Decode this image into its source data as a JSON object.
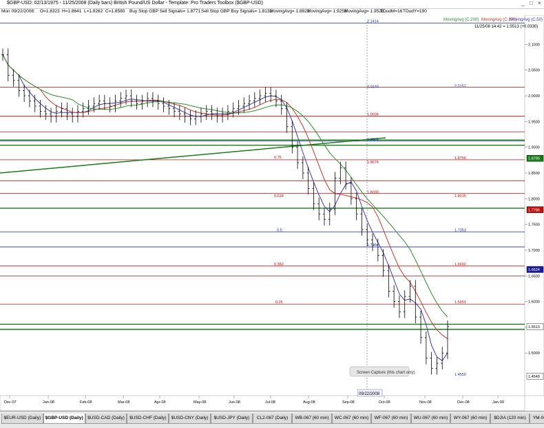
{
  "window": {
    "title": "$GBP-USD:  02/13/1975 - 11/25/2008  (Daily bars)   British Pound/US Dollar  -  Template: Pro Traders Toolbox ($GBP-USD)"
  },
  "info": {
    "date": "Mon 09/22/2008:",
    "o": "O=1.8323",
    "h": "H=1.8641",
    "l": "L=1.8262",
    "c": "C=1.8580",
    "buy_stop_sell": "Buy Stop GBP Sell Signals= 1.8771",
    "sell_stop_buy": "Sell Stop GBP Buy Signals= 1.8132",
    "ma1": "MovingAvg= 1.8822",
    "ma2": "MovingAvg= 1.9258",
    "ma3": "MovingAvg= 1.9528",
    "tdudm": "TDudM=16",
    "tdudy": "TDudY=190"
  },
  "legend": {
    "ma200": "MovingAvg (C,200)",
    "ma100": "MovingAvg (C,100)",
    "ma50": "MovingAvg (C,50)",
    "status": "11/25/08 14:42 = 1.5513 (+0.0330)",
    "colors": {
      "ma200": "#2e8b2e",
      "ma100": "#c0392b",
      "ma50": "#3a3ab0"
    }
  },
  "chart_data": {
    "type": "candlestick",
    "ylim": [
      1.44,
      2.13
    ],
    "y_ticks": [
      "2.1000",
      "2.0500",
      "2.0000",
      "1.9500",
      "1.9000",
      "1.8500",
      "1.8000",
      "1.7500",
      "1.7000",
      "1.6500",
      "1.6000",
      "1.5500",
      "1.5000"
    ],
    "x_ticks": [
      "Dec-07",
      "Jan-08",
      "Feb-08",
      "Mar-08",
      "Apr-08",
      "May-08",
      "Jun-08",
      "Jul-08",
      "Aug-08",
      "Sep-08",
      "Oct-08",
      "Nov-08",
      "Dec-08",
      "Jan-09"
    ],
    "cursor_date": "09/22/2008",
    "right_axis_markers": [
      {
        "label": "1.8785",
        "value": 1.8785,
        "color": "#1a7a1a"
      },
      {
        "label": "1.7786",
        "value": 1.7786,
        "color": "#c01010"
      },
      {
        "label": "1.6624",
        "value": 1.6624,
        "color": "#1a1a9a"
      },
      {
        "label": "1.5513",
        "value": 1.5513,
        "color": "#000000"
      },
      {
        "label": "1.4549",
        "value": 1.4549,
        "color": "#000000"
      }
    ],
    "level_labels": [
      {
        "label": "2.1414",
        "value": 2.1414,
        "color": "#2030a0"
      },
      {
        "label": "2.0140",
        "value": 2.014,
        "color": "#2030a0"
      },
      {
        "label": "2.0157",
        "value": 2.0157,
        "color": "#2030a0"
      },
      {
        "label": "1.9604",
        "value": 1.9604,
        "color": "#c01010"
      },
      {
        "label": "1.9119",
        "value": 1.9119,
        "color": "#2030a0"
      },
      {
        "label": "0.75",
        "value": 1.877,
        "color": "#c01010"
      },
      {
        "label": "1.8756",
        "value": 1.8756,
        "color": "#c01010"
      },
      {
        "label": "1.8674",
        "value": 1.8674,
        "color": "#c01010"
      },
      {
        "label": "1.8090",
        "value": 1.809,
        "color": "#c01010"
      },
      {
        "label": "0.618",
        "value": 1.8015,
        "color": "#c01010"
      },
      {
        "label": "1.8015",
        "value": 1.8015,
        "color": "#c01010"
      },
      {
        "label": "0.5",
        "value": 1.7353,
        "color": "#2030a0"
      },
      {
        "label": "1.7353",
        "value": 1.7353,
        "color": "#2030a0"
      },
      {
        "label": "1.7064",
        "value": 1.7064,
        "color": "#2030a0"
      },
      {
        "label": "0.382",
        "value": 1.6692,
        "color": "#c01010"
      },
      {
        "label": "1.6692",
        "value": 1.6692,
        "color": "#c01010"
      },
      {
        "label": "0.25",
        "value": 1.5951,
        "color": "#c01010"
      },
      {
        "label": "1.5951",
        "value": 1.5951,
        "color": "#c01010"
      },
      {
        "label": "1.4550",
        "value": 1.455,
        "color": "#2030a0"
      }
    ],
    "horizontal_lines": [
      {
        "value": 2.1414,
        "color": "#2030a0"
      },
      {
        "value": 2.017,
        "color": "#8b1a1a"
      },
      {
        "value": 1.9604,
        "color": "#c01010"
      },
      {
        "value": 1.93,
        "color": "#8b1a1a"
      },
      {
        "value": 1.914,
        "color": "#1a7a1a"
      },
      {
        "value": 1.9119,
        "color": "#2030a0"
      },
      {
        "value": 1.904,
        "color": "#1a7a1a"
      },
      {
        "value": 1.8756,
        "color": "#c01010"
      },
      {
        "value": 1.835,
        "color": "#8b1a1a"
      },
      {
        "value": 1.8105,
        "color": "#c01010"
      },
      {
        "value": 1.7815,
        "color": "#1a7a1a"
      },
      {
        "value": 1.7353,
        "color": "#2030a0"
      },
      {
        "value": 1.7064,
        "color": "#2030a0"
      },
      {
        "value": 1.6692,
        "color": "#c01010"
      },
      {
        "value": 1.65,
        "color": "#8b1a1a"
      },
      {
        "value": 1.5951,
        "color": "#c01010"
      },
      {
        "value": 1.556,
        "color": "#1a7a1a"
      },
      {
        "value": 1.546,
        "color": "#1a7a1a"
      }
    ],
    "close_series": [
      2.08,
      2.04,
      2.03,
      2.01,
      2.0,
      1.99,
      1.98,
      1.97,
      1.965,
      1.96,
      1.97,
      1.975,
      1.965,
      1.96,
      1.97,
      1.975,
      1.98,
      1.985,
      1.99,
      1.985,
      1.98,
      1.99,
      1.995,
      2.0,
      1.99,
      1.985,
      1.99,
      1.995,
      1.99,
      1.985,
      1.98,
      1.975,
      1.97,
      1.965,
      1.96,
      1.955,
      1.96,
      1.965,
      1.97,
      1.965,
      1.96,
      1.965,
      1.97,
      1.975,
      1.98,
      1.985,
      1.99,
      1.995,
      2.0,
      2.005,
      2.0,
      1.99,
      1.975,
      1.94,
      1.9,
      1.87,
      1.85,
      1.82,
      1.79,
      1.77,
      1.76,
      1.78,
      1.84,
      1.86,
      1.83,
      1.8,
      1.77,
      1.74,
      1.72,
      1.71,
      1.69,
      1.66,
      1.62,
      1.6,
      1.58,
      1.61,
      1.63,
      1.57,
      1.53,
      1.49,
      1.47,
      1.48,
      1.5,
      1.5513
    ]
  },
  "annotation": "Screen Capture (this chart only)",
  "tabs": [
    "$EUR-USD (Daily)",
    "$GBP-USD (Daily)",
    "$USD-CAD (Daily)",
    "$USD-CHF (Daily)",
    "$USD-CNY (Daily)",
    "$USD-JPY (Daily)",
    "CL2-067 (Daily)",
    "WB-067 (60 min)",
    "WC-067 (60 min)",
    "WF-067 (60 min)",
    "WU-067 (60 min)",
    "WY-067 (60 min)",
    "$DJIA (120 min)",
    "YM-067 (60 min)"
  ],
  "active_tab": 1
}
